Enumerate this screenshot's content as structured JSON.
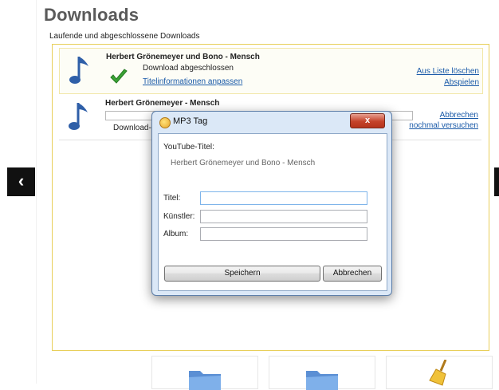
{
  "page": {
    "title": "Downloads",
    "subtitle": "Laufende und abgeschlossene Downloads"
  },
  "downloads": [
    {
      "title": "Herbert Grönemeyer und Bono - Mensch",
      "status": "Download abgeschlossen",
      "info_link": "Titelinformationen anpassen",
      "actions": [
        "Aus Liste löschen",
        "Abspielen"
      ]
    },
    {
      "title": "Herbert Grönemeyer - Mensch",
      "status": "Download-L",
      "actions": [
        "Abbrechen",
        "nochmal versuchen"
      ]
    }
  ],
  "nav": {
    "prev_icon": "chevron-left-icon",
    "next_icon": "chevron-right-icon"
  },
  "tiles": [
    "folder-icon",
    "folder-icon",
    "broom-icon"
  ],
  "dialog": {
    "title": "MP3 Tag",
    "close_label": "x",
    "youtube_label": "YouTube-Titel:",
    "youtube_value": "Herbert Grönemeyer und Bono - Mensch",
    "fields": [
      {
        "label": "Titel:",
        "value": ""
      },
      {
        "label": "Künstler:",
        "value": ""
      },
      {
        "label": "Album:",
        "value": ""
      }
    ],
    "save_label": "Speichern",
    "cancel_label": "Abbrechen"
  },
  "colors": {
    "accent_border": "#e8cf5a",
    "link": "#1a5aa8",
    "note_icon": "#2f5fa8",
    "check_icon": "#3aa335",
    "close_button": "#c4422a"
  }
}
